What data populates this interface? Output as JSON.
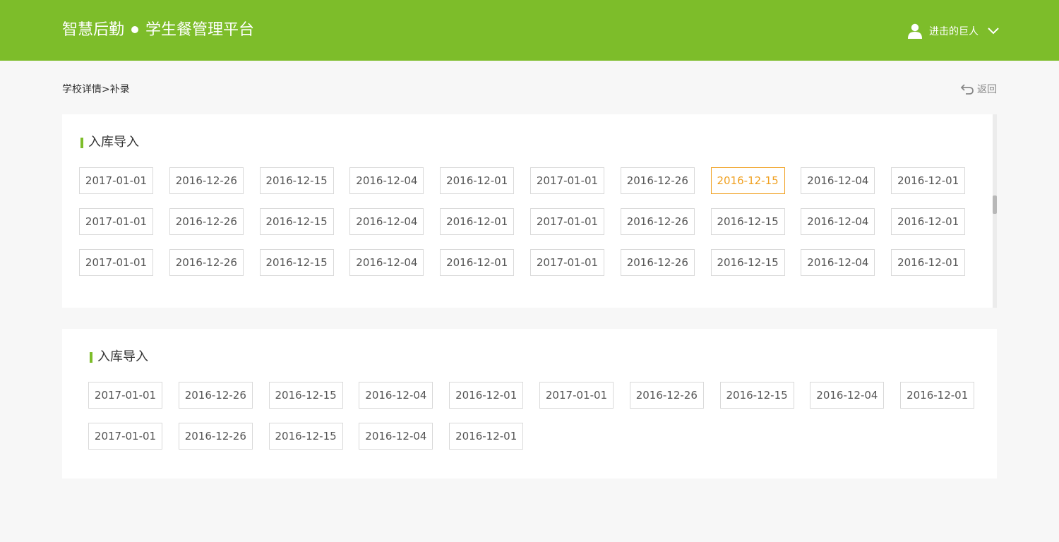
{
  "header": {
    "brand_left": "智慧后勤",
    "brand_right": "学生餐管理平台",
    "user_name": "进击的巨人"
  },
  "breadcrumb": {
    "parent": "学校详情",
    "separator": ">",
    "current": "补录"
  },
  "back_label": "返回",
  "colors": {
    "header_bg": "#7dbd2a",
    "accent": "#7dbd2a",
    "selected": "#f0a020"
  },
  "sections": [
    {
      "title": "入库导入",
      "selected_index": 7,
      "dates": [
        "2017-01-01",
        "2016-12-26",
        "2016-12-15",
        "2016-12-04",
        "2016-12-01",
        "2017-01-01",
        "2016-12-26",
        "2016-12-15",
        "2016-12-04",
        "2016-12-01",
        "2017-01-01",
        "2016-12-26",
        "2016-12-15",
        "2016-12-04",
        "2016-12-01",
        "2017-01-01",
        "2016-12-26",
        "2016-12-15",
        "2016-12-04",
        "2016-12-01",
        "2017-01-01",
        "2016-12-26",
        "2016-12-15",
        "2016-12-04",
        "2016-12-01",
        "2017-01-01",
        "2016-12-26",
        "2016-12-15",
        "2016-12-04",
        "2016-12-01"
      ]
    },
    {
      "title": "入库导入",
      "selected_index": -1,
      "dates": [
        "2017-01-01",
        "2016-12-26",
        "2016-12-15",
        "2016-12-04",
        "2016-12-01",
        "2017-01-01",
        "2016-12-26",
        "2016-12-15",
        "2016-12-04",
        "2016-12-01",
        "2017-01-01",
        "2016-12-26",
        "2016-12-15",
        "2016-12-04",
        "2016-12-01"
      ]
    }
  ],
  "icons": {
    "user": "user-icon",
    "dropdown": "chevron-down-icon",
    "back": "back-arrow-icon"
  }
}
